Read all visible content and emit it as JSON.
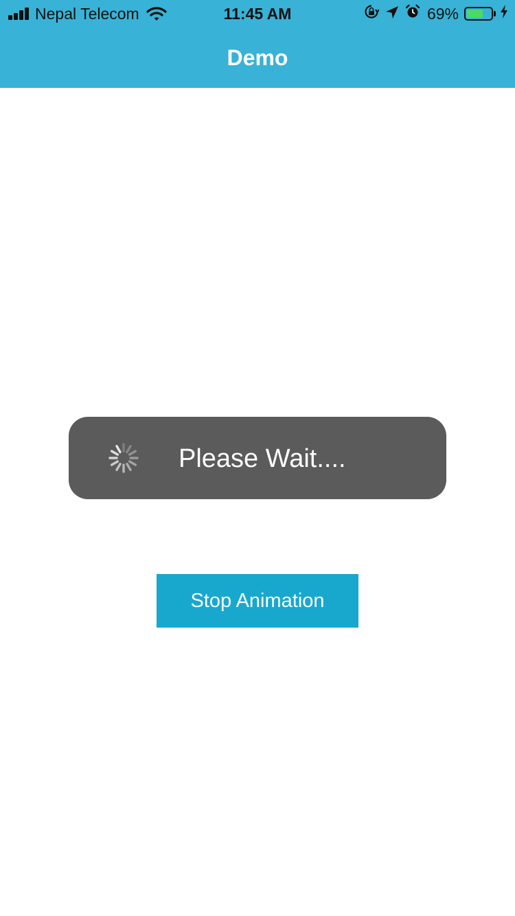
{
  "status_bar": {
    "carrier": "Nepal Telecom",
    "time": "11:45 AM",
    "battery_percent": "69%",
    "battery_level": 0.69,
    "icons": [
      "signal-icon",
      "wifi-icon",
      "orientation-lock-icon",
      "location-arrow-icon",
      "alarm-icon",
      "battery-icon",
      "charging-bolt-icon"
    ]
  },
  "nav": {
    "title": "Demo"
  },
  "loader": {
    "message": "Please Wait....",
    "icon": "spinner-icon"
  },
  "actions": {
    "stop_label": "Stop Animation"
  },
  "colors": {
    "header": "#38b2d6",
    "loader_bg": "#5b5b5b",
    "button_bg": "#18a8ce",
    "battery_fill": "#4cd964"
  }
}
